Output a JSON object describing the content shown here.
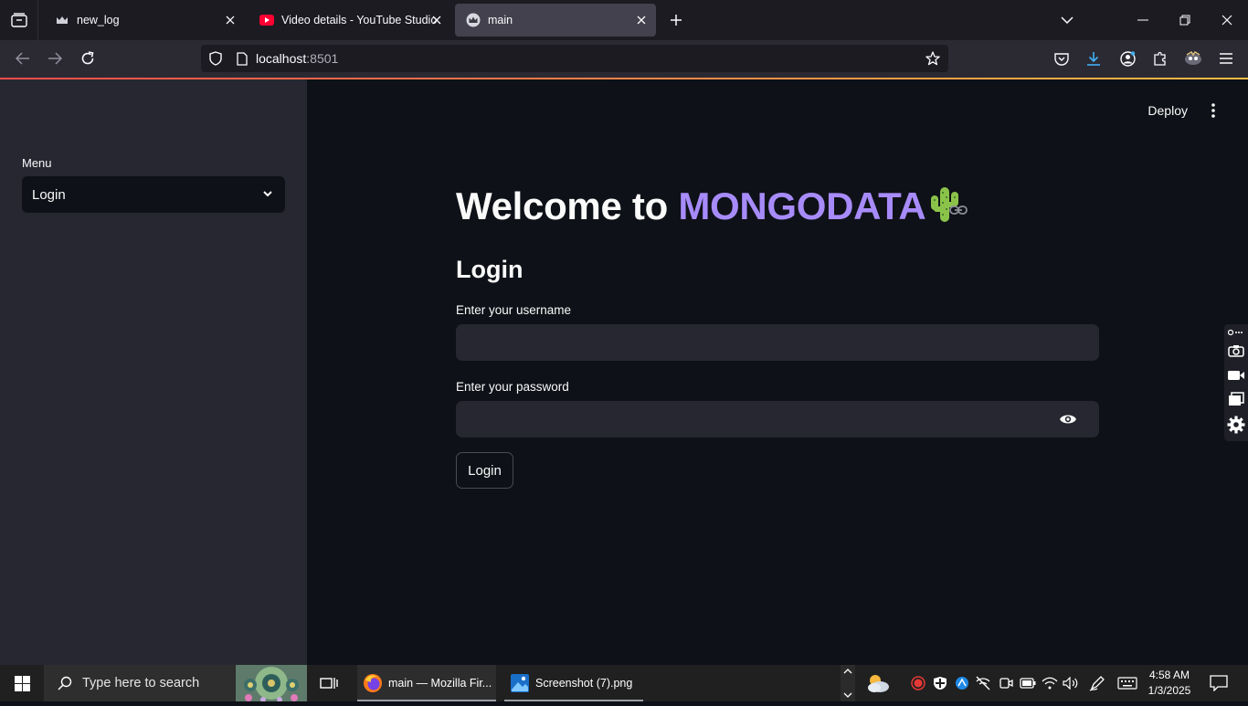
{
  "browser": {
    "tabs": [
      {
        "title": "new_log",
        "favicon": "streamlit-crown-icon",
        "active": false
      },
      {
        "title": "Video details - YouTube Studio",
        "favicon": "youtube-icon",
        "active": false
      },
      {
        "title": "main",
        "favicon": "streamlit-crown-icon",
        "active": true
      }
    ],
    "url_host": "localhost",
    "url_port": ":8501"
  },
  "app": {
    "deploy_label": "Deploy",
    "sidebar": {
      "menu_label": "Menu",
      "menu_selected": "Login"
    },
    "title_prefix": "Welcome to ",
    "title_brand": "MONGODATA",
    "title_emoji": "cactus",
    "brand_color": "#a78bfa",
    "subtitle": "Login",
    "username_label": "Enter your username",
    "username_value": "",
    "password_label": "Enter your password",
    "password_value": "",
    "login_button": "Login"
  },
  "taskbar": {
    "search_placeholder": "Type here to search",
    "apps": [
      {
        "label": "main — Mozilla Fir...",
        "icon": "firefox-icon"
      },
      {
        "label": "Screenshot (7).png",
        "icon": "photos-icon"
      }
    ],
    "time": "4:58 AM",
    "date": "1/3/2025"
  }
}
